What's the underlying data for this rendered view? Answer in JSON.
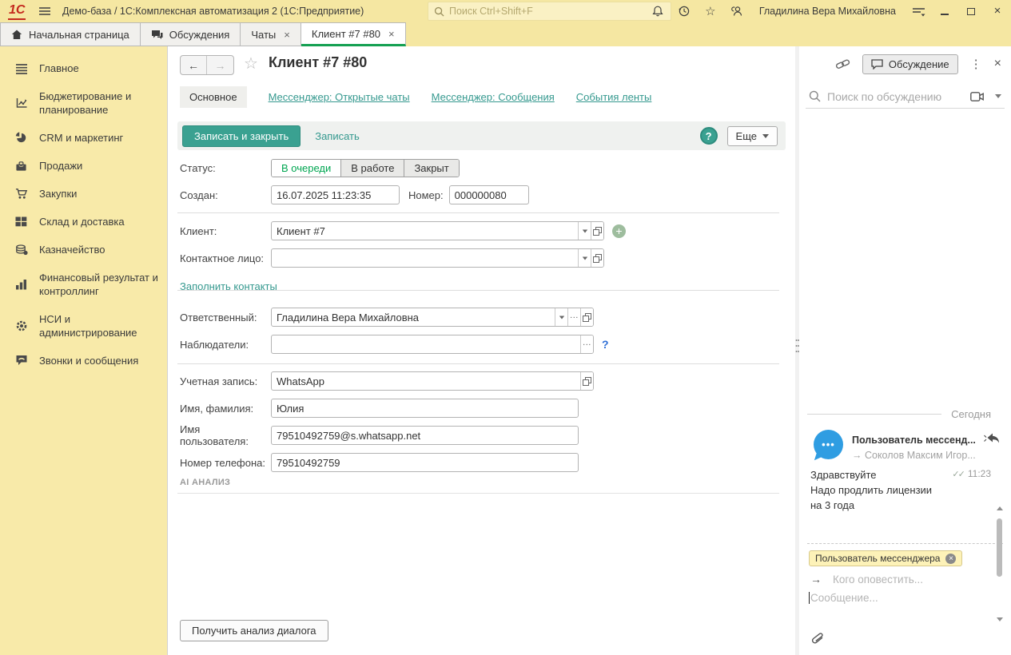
{
  "colors": {
    "accent_teal": "#3aa191",
    "status_green": "#00a651",
    "topbar_yellow": "#f5e7a2",
    "avatar_blue": "#2f9de2",
    "tab_active_underline": "#15a052"
  },
  "icons": {
    "logo_text": "1С",
    "ellipsis": "...",
    "dots_vertical": "⋮",
    "close": "×",
    "star_outline": "☆",
    "question_mark": "?",
    "plus": "+",
    "back_arrow": "←",
    "forward_arrow": "→",
    "arrow_right": "→",
    "read_receipt": "✓✓",
    "avatar_dots": "•••"
  },
  "topbar": {
    "app_title": "Демо-база / 1С:Комплексная автоматизация 2  (1С:Предприятие)",
    "search_placeholder": "Поиск Ctrl+Shift+F",
    "user_name": "Гладилина Вера Михайловна"
  },
  "tabbar": {
    "tabs": [
      {
        "label": "Начальная страница"
      },
      {
        "label": "Обсуждения"
      },
      {
        "label": "Чаты"
      },
      {
        "label": "Клиент #7 #80"
      }
    ]
  },
  "sidebar": {
    "items": [
      {
        "label": "Главное"
      },
      {
        "label": "Бюджетирование и планирование"
      },
      {
        "label": "CRM и маркетинг"
      },
      {
        "label": "Продажи"
      },
      {
        "label": "Закупки"
      },
      {
        "label": "Склад и доставка"
      },
      {
        "label": "Казначейство"
      },
      {
        "label": "Финансовый результат и контроллинг"
      },
      {
        "label": "НСИ и администрирование"
      },
      {
        "label": "Звонки и сообщения"
      }
    ]
  },
  "form": {
    "title": "Клиент #7 #80",
    "nav": [
      "Основное",
      "Мессенджер: Открытые чаты",
      "Мессенджер: Сообщения",
      "События ленты"
    ],
    "toolbar": {
      "save_close": "Записать и закрыть",
      "save": "Записать",
      "more": "Еще"
    },
    "fields": {
      "status": {
        "label": "Статус:",
        "options": [
          "В очереди",
          "В работе",
          "Закрыт"
        ],
        "selected": "В очереди"
      },
      "created": {
        "label": "Создан:",
        "value": "16.07.2025 11:23:35"
      },
      "number": {
        "label": "Номер:",
        "value": "000000080"
      },
      "client": {
        "label": "Клиент:",
        "value": "Клиент #7"
      },
      "contact": {
        "label": "Контактное лицо:",
        "value": ""
      },
      "fill_contacts_link": "Заполнить контакты",
      "responsible": {
        "label": "Ответственный:",
        "value": "Гладилина Вера Михайловна"
      },
      "watchers": {
        "label": "Наблюдатели:",
        "value": ""
      },
      "account": {
        "label": "Учетная запись:",
        "value": "WhatsApp"
      },
      "person_name": {
        "label": "Имя, фамилия:",
        "value": "Юлия"
      },
      "username": {
        "label": "Имя пользователя:",
        "value": "79510492759@s.whatsapp.net"
      },
      "phone": {
        "label": "Номер телефона:",
        "value": "79510492759"
      }
    },
    "ai_section": {
      "title": "AI АНАЛИЗ",
      "analyze_button": "Получить анализ диалога"
    }
  },
  "discussion": {
    "panel_title": "Обсуждение",
    "search_placeholder": "Поиск по обсуждению",
    "date_divider": "Сегодня",
    "message": {
      "sender": "Пользователь мессенд...",
      "recipient": "→ Соколов Максим Игор...",
      "lines": [
        "Здравствуйте",
        "Надо продлить лицензии",
        "на 3 года"
      ],
      "time": "11:23"
    },
    "reply": {
      "tag": "Пользователь мессенджера",
      "notify_placeholder": "Кого оповестить...",
      "message_placeholder": "Сообщение..."
    }
  }
}
